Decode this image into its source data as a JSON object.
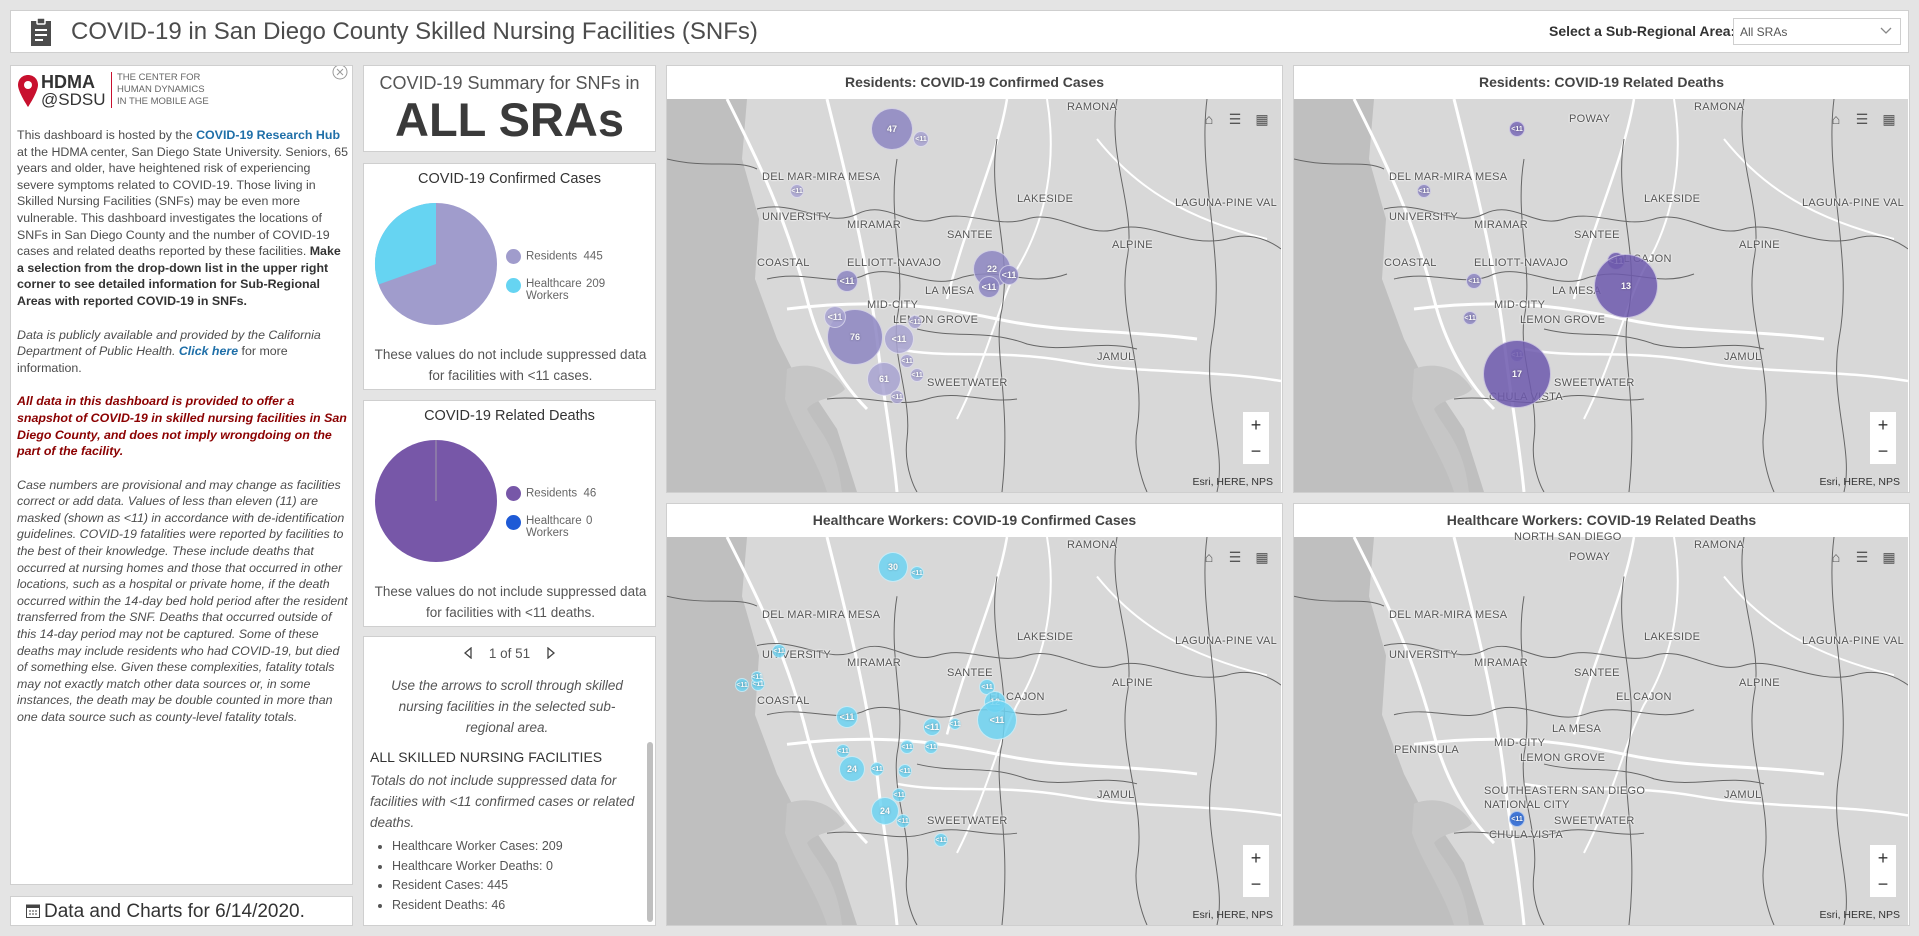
{
  "header": {
    "title": "COVID-19 in San Diego County Skilled Nursing Facilities (SNFs)",
    "select_label": "Select a Sub-Regional Area:",
    "select_value": "All SRAs"
  },
  "info": {
    "logo_primary": "HDMA",
    "logo_secondary": "@SDSU",
    "logo_tag1": "THE CENTER FOR",
    "logo_tag2": "HUMAN DYNAMICS",
    "logo_tag3": "IN THE MOBILE AGE",
    "p1_a": "This dashboard is hosted by the ",
    "p1_link": "COVID-19 Research Hub",
    "p1_b": " at the HDMA center, San Diego State University. Seniors, 65 years and older, have heightened risk of experiencing severe symptoms related to COVID-19. Those living in Skilled Nursing Facilities (SNFs) may be even more vulnerable. This dashboard investigates the locations of SNFs in San Diego County and the number of COVID-19 cases and related deaths reported by these facilities. ",
    "p1_bold": "Make a selection from the drop-down list in the upper right corner to see detailed information for Sub-Regional Areas with reported COVID-19 in SNFs.",
    "p2_a": "Data is publicly available and provided by the California Department of Public Health. ",
    "p2_link": "Click here",
    "p2_b": " for more information.",
    "p3": "All data in this dashboard is provided to offer a snapshot of COVID-19 in skilled nursing facilities in San Diego County, and does not imply wrongdoing on the part of the facility.",
    "p4": "Case numbers are provisional and may change as facilities correct or add data.  Values of less than eleven (11) are masked (shown as <11) in accordance with de-identification guidelines. COVID-19 fatalities were reported by facilities to the best of their knowledge. These include deaths that occurred at nursing homes and those that occurred in other locations, such as a hospital or private home, if the death occurred within the 14-day bed hold period after the resident transferred from the SNF. Deaths that occurred outside of this 14-day period may not be captured. Some of these deaths may include residents who had COVID-19, but died of something else. Given these complexities, fatality totals may not exactly match other data sources or, in some instances, the death may be double counted in more than one data source such as county-level fatality totals."
  },
  "footer": {
    "label": "Data and Charts for 6/14/2020."
  },
  "summary": {
    "line1": "COVID-19 Summary for SNFs in",
    "line2": "ALL SRAs"
  },
  "cases_chart": {
    "title": "COVID-19 Confirmed Cases",
    "legend": [
      {
        "label": "Residents",
        "value": "445",
        "color": "#a09ccc"
      },
      {
        "label": "Healthcare Workers",
        "value": "209",
        "color": "#66d4f2"
      }
    ],
    "note": "These values do not include suppressed data for facilities with <11 cases."
  },
  "deaths_chart": {
    "title": "COVID-19 Related Deaths",
    "legend": [
      {
        "label": "Residents",
        "value": "46",
        "color": "#7757a8"
      },
      {
        "label": "Healthcare Workers",
        "value": "0",
        "color": "#1e5ad6"
      }
    ],
    "note": "These values do not include suppressed data for facilities with <11 deaths."
  },
  "facilities": {
    "pager": "1 of 51",
    "hint": "Use the arrows to scroll through skilled nursing facilities in the selected sub-regional area.",
    "heading": "ALL SKILLED NURSING FACILITIES",
    "subtext": "Totals do not include suppressed data for facilities with <11 confirmed cases or related deaths.",
    "items": [
      "Healthcare Worker Cases: 209",
      "Healthcare Worker Deaths: 0",
      "Resident Cases: 445",
      "Resident Deaths: 46"
    ]
  },
  "maps": [
    {
      "title": "Residents: COVID-19 Confirmed Cases",
      "places": [
        "RAMONA",
        "DEL MAR-MIRA MESA",
        "LAKESIDE",
        "LAGUNA-PINE VAL",
        "UNIVERSITY",
        "MIRAMAR",
        "SANTEE",
        "ALPINE",
        "COASTAL",
        "ELLIOTT-NAVAJO",
        "LA MESA",
        "MID-CITY",
        "LEMON GROVE",
        "JAMUL",
        "SWEETWATER"
      ],
      "bubbles": [
        "47",
        "<11",
        "<11",
        "<11",
        "22",
        "<11",
        "<11",
        "<11",
        "76",
        "<11",
        "<11",
        "61",
        "<11",
        "<11",
        "<11"
      ],
      "attribution": "Esri, HERE, NPS"
    },
    {
      "title": "Residents: COVID-19 Related Deaths",
      "places": [
        "RAMONA",
        "POWAY",
        "DEL MAR-MIRA MESA",
        "LAKESIDE",
        "LAGUNA-PINE VAL",
        "UNIVERSITY",
        "MIRAMAR",
        "SANTEE",
        "ALPINE",
        "COASTAL",
        "ELLIOTT-NAVAJO",
        "EL CAJON",
        "LA MESA",
        "MID-CITY",
        "LEMON GROVE",
        "JAMUL",
        "SWEETWATER",
        "CHULA VISTA"
      ],
      "bubbles": [
        "<11",
        "<11",
        "<11",
        "<11",
        "13",
        "<11",
        "<11",
        "17"
      ],
      "attribution": "Esri, HERE, NPS"
    },
    {
      "title": "Healthcare Workers: COVID-19 Confirmed Cases",
      "places": [
        "RAMONA",
        "DEL MAR-MIRA MESA",
        "LAKESIDE",
        "LAGUNA-PINE VAL",
        "UNIVERSITY",
        "MIRAMAR",
        "SANTEE",
        "ALPINE",
        "COASTAL",
        "EL CAJON",
        "JAMUL",
        "SWEETWATER"
      ],
      "bubbles": [
        "30",
        "<11",
        "<11",
        "<11",
        "<11",
        "<11",
        "<11",
        "<11",
        "12",
        "<11",
        "<11",
        "<11",
        "<11",
        "<11",
        "24",
        "<11",
        "<11",
        "<11",
        "<11",
        "24",
        "<11",
        "<11"
      ],
      "attribution": "Esri, HERE, NPS"
    },
    {
      "title": "Healthcare Workers: COVID-19 Related Deaths",
      "places": [
        "RAMONA",
        "NORTH SAN DIEGO",
        "POWAY",
        "DEL MAR-MIRA MESA",
        "LAKESIDE",
        "LAGUNA-PINE VAL",
        "UNIVERSITY",
        "MIRAMAR",
        "SANTEE",
        "ALPINE",
        "EL CAJON",
        "LA MESA",
        "MID-CITY",
        "PENINSULA",
        "LEMON GROVE",
        "JAMUL",
        "SOUTHEASTERN SAN DIEGO",
        "NATIONAL CITY",
        "SWEETWATER",
        "CHULA VISTA"
      ],
      "bubbles": [
        "<11"
      ],
      "attribution": "Esri, HERE, NPS"
    }
  ]
}
